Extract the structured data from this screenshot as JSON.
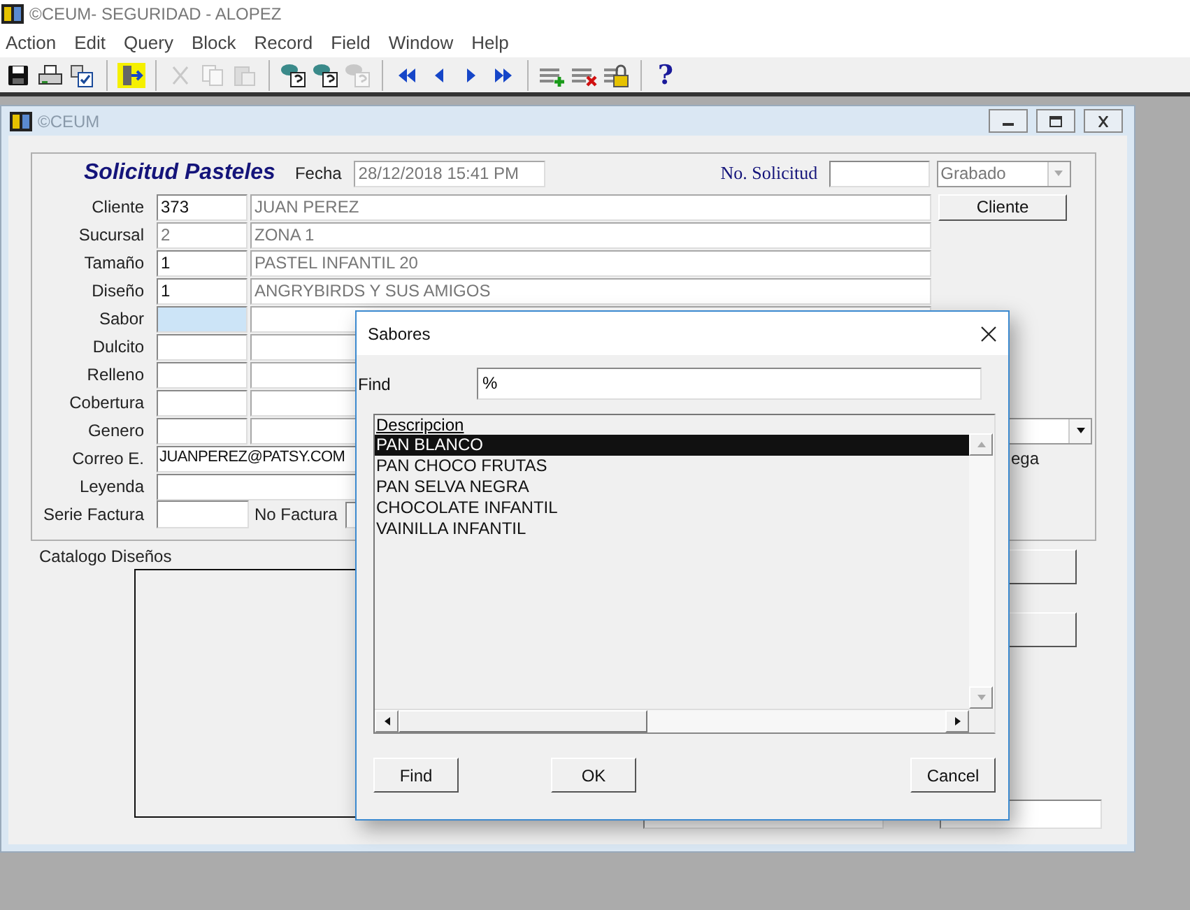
{
  "app_title": "©CEUM- SEGURIDAD - ALOPEZ",
  "menu": [
    "Action",
    "Edit",
    "Query",
    "Block",
    "Record",
    "Field",
    "Window",
    "Help"
  ],
  "toolbar": [
    [
      {
        "kind": "save",
        "disabled": false
      },
      {
        "kind": "print",
        "disabled": false
      },
      {
        "kind": "check",
        "disabled": false
      }
    ],
    [
      {
        "kind": "exit",
        "disabled": false
      }
    ],
    [
      {
        "kind": "cut",
        "disabled": true
      },
      {
        "kind": "copy",
        "disabled": true
      },
      {
        "kind": "paste",
        "disabled": true
      }
    ],
    [
      {
        "kind": "query",
        "disabled": false
      },
      {
        "kind": "query",
        "disabled": false
      },
      {
        "kind": "query",
        "disabled": true
      }
    ],
    [
      {
        "kind": "first",
        "disabled": false
      },
      {
        "kind": "prev",
        "disabled": false
      },
      {
        "kind": "next",
        "disabled": false
      },
      {
        "kind": "last",
        "disabled": false
      }
    ],
    [
      {
        "kind": "insert",
        "disabled": false
      },
      {
        "kind": "delete",
        "disabled": false
      },
      {
        "kind": "lock",
        "disabled": false
      }
    ],
    [
      {
        "kind": "help",
        "disabled": false,
        "label": "?"
      }
    ]
  ],
  "child_window": {
    "title": "©CEUM"
  },
  "form": {
    "title": "Solicitud Pasteles",
    "fecha_label": "Fecha",
    "fecha": "28/12/2018 15:41 PM",
    "solicitud_label": "No. Solicitud",
    "status": "Grabado",
    "cliente_button": "Cliente",
    "rows": [
      {
        "kind": "lookup",
        "label": "Cliente",
        "code": "373",
        "description": "JUAN PEREZ",
        "disabled": false,
        "focused": false,
        "dropdown": false
      },
      {
        "kind": "lookup",
        "label": "Sucursal",
        "code": "2",
        "description": "ZONA 1",
        "disabled": true,
        "focused": false,
        "dropdown": false
      },
      {
        "kind": "lookup",
        "label": "Tamaño",
        "code": "1",
        "description": "PASTEL INFANTIL 20",
        "disabled": false,
        "focused": false,
        "dropdown": false
      },
      {
        "kind": "lookup",
        "label": "Diseño",
        "code": "1",
        "description": "ANGRYBIRDS Y SUS AMIGOS",
        "disabled": false,
        "focused": false,
        "dropdown": false
      },
      {
        "kind": "lookup",
        "label": "Sabor",
        "disabled": false,
        "focused": true,
        "dropdown": false
      },
      {
        "kind": "lookup",
        "label": "Dulcito",
        "disabled": false,
        "focused": false,
        "dropdown": false
      },
      {
        "kind": "lookup",
        "label": "Relleno",
        "disabled": false,
        "focused": false,
        "dropdown": false
      },
      {
        "kind": "lookup",
        "label": "Cobertura",
        "disabled": false,
        "focused": false,
        "dropdown": false
      },
      {
        "kind": "lookup",
        "label": "Genero",
        "disabled": false,
        "focused": false,
        "dropdown": true
      },
      {
        "kind": "text",
        "label": "Correo E.",
        "value": "JUANPEREZ@PATSY.COM",
        "side_label": "ega"
      },
      {
        "kind": "text",
        "label": "Leyenda"
      },
      {
        "kind": "factura",
        "label": "Serie Factura",
        "label_2": "No Factura"
      }
    ],
    "catalog_label": "Catalogo Diseños"
  },
  "dialog": {
    "title": "Sabores",
    "find_label": "Find",
    "find_value": "%",
    "column": "Descripcion",
    "items": [
      {
        "text": "PAN BLANCO",
        "selected": true
      },
      {
        "text": "PAN CHOCO FRUTAS",
        "selected": false
      },
      {
        "text": "PAN SELVA NEGRA",
        "selected": false
      },
      {
        "text": "CHOCOLATE INFANTIL",
        "selected": false
      },
      {
        "text": "VAINILLA INFANTIL",
        "selected": false
      }
    ],
    "buttons": [
      "Find",
      "OK",
      "Cancel"
    ]
  }
}
